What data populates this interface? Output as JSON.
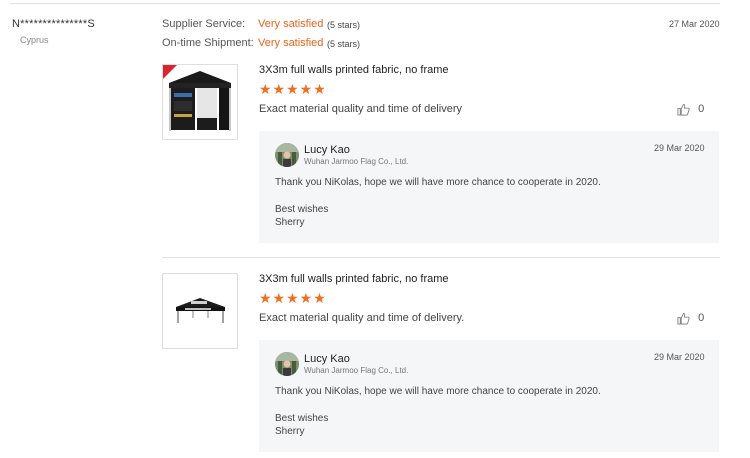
{
  "buyer": {
    "name": "N***************S",
    "country": "Cyprus"
  },
  "ratings": {
    "supplier_service": {
      "label": "Supplier Service:",
      "value": "Very satisfied",
      "stars": "(5 stars)"
    },
    "ontime_shipment": {
      "label": "On-time Shipment:",
      "value": "Very satisfied",
      "stars": "(5 stars)"
    },
    "date": "27 Mar 2020"
  },
  "reviews": [
    {
      "title": "3X3m full walls printed fabric, no frame",
      "stars": "★★★★★",
      "rating": 5,
      "text": "Exact material quality and time of delivery",
      "likes": "0",
      "reply": {
        "name": "Lucy Kao",
        "company": "Wuhan Jarmoo Flag Co., Ltd.",
        "date": "29 Mar 2020",
        "message": "Thank you NiKolas, hope we will have more chance to cooperate in 2020.",
        "closing": "Best wishes",
        "signature": "Sherry"
      }
    },
    {
      "title": "3X3m full walls printed fabric, no frame",
      "stars": "★★★★★",
      "rating": 5,
      "text": "Exact material quality and time of delivery.",
      "likes": "0",
      "reply": {
        "name": "Lucy Kao",
        "company": "Wuhan Jarmoo Flag Co., Ltd.",
        "date": "29 Mar 2020",
        "message": "Thank you NiKolas, hope we will have more chance to cooperate in 2020.",
        "closing": "Best wishes",
        "signature": "Sherry"
      }
    }
  ],
  "icons": {
    "like": "thumbs-up-icon"
  },
  "colors": {
    "accent": "#e8631a",
    "star": "#f36d21",
    "reply_bg": "#f5f6f7"
  }
}
